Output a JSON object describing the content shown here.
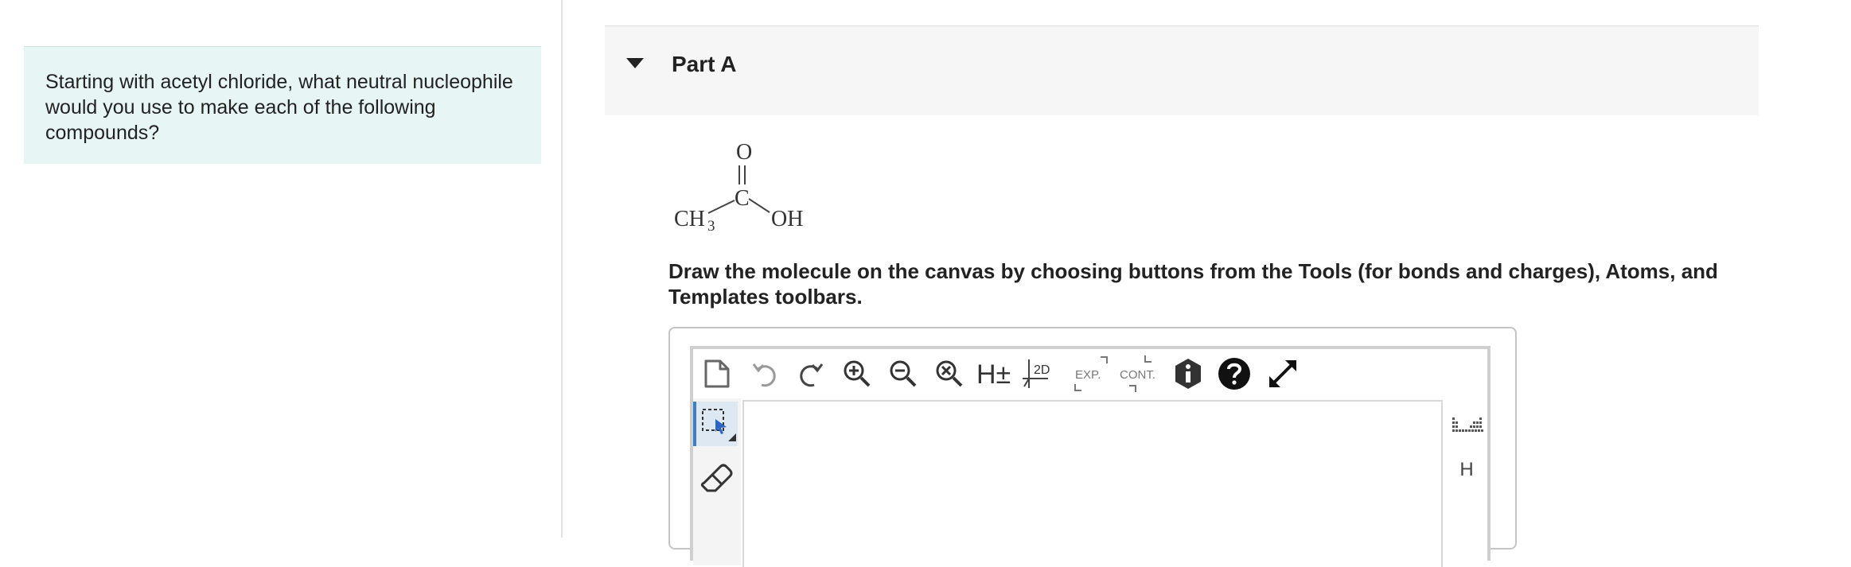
{
  "question": {
    "text": "Starting with acetyl chloride, what neutral nucleophile would you use to make each of the following compounds?"
  },
  "part": {
    "title": "Part A"
  },
  "molecule": {
    "oxygen_top": "O",
    "carbon": "C",
    "methyl": "CH",
    "methyl_subscript": "3",
    "hydroxyl": "OH"
  },
  "instructions": {
    "text": "Draw the molecule on the canvas by choosing buttons from the Tools (for bonds and charges), Atoms, and Templates toolbars."
  },
  "editor": {
    "toolbar": {
      "hydrogens_label": "H±",
      "two_d_label": "2D",
      "expand_label": "EXP.",
      "contract_label": "CONT."
    },
    "atoms": {
      "hydrogen": "H"
    }
  },
  "colors": {
    "question_bg": "#e7f5f5",
    "part_header_bg": "#f6f6f6",
    "select_accent": "#3a7fc8"
  }
}
